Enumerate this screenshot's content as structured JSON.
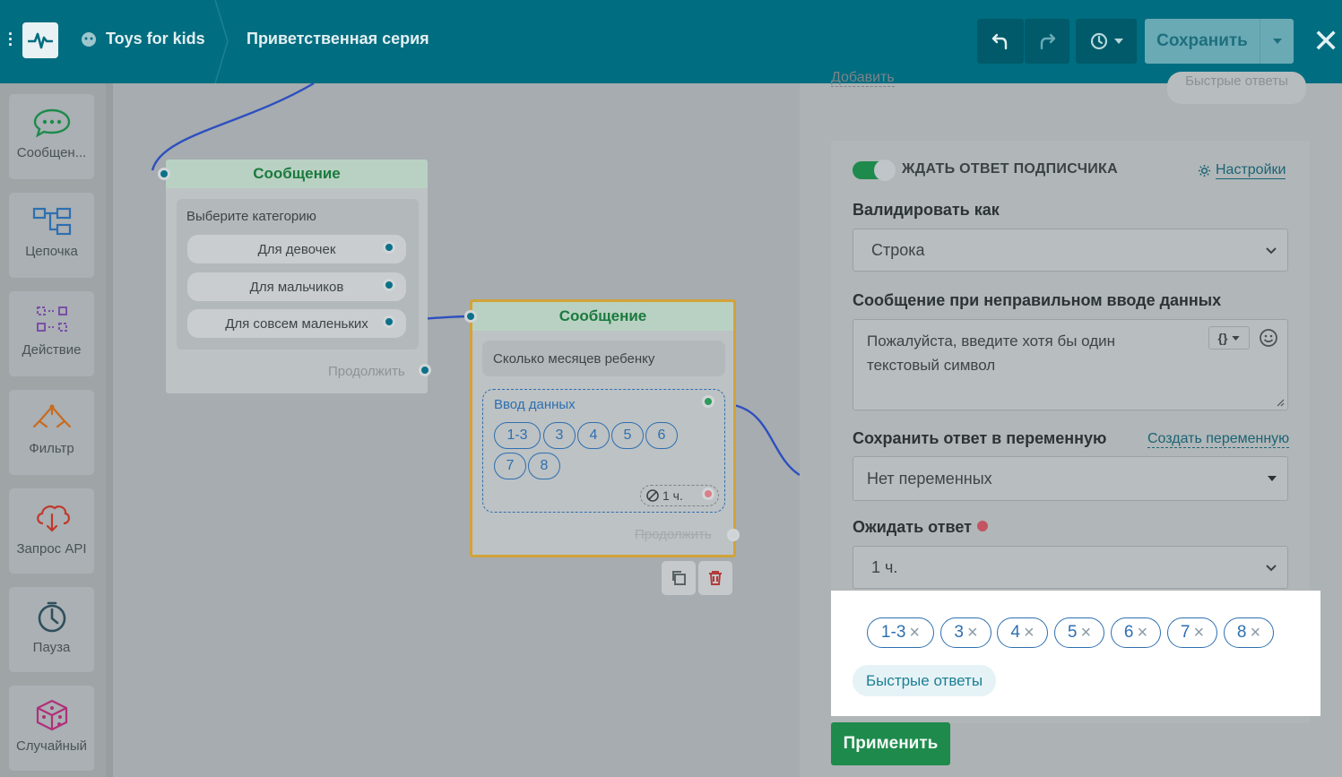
{
  "topbar": {
    "project_name": "Toys for kids",
    "series_name": "Приветственная серия",
    "save_label": "Сохранить"
  },
  "sidebar": {
    "items": [
      {
        "label": "Сообщен...",
        "icon": "chat-bubble-icon"
      },
      {
        "label": "Цепочка",
        "icon": "flowchart-icon"
      },
      {
        "label": "Действие",
        "icon": "action-icon"
      },
      {
        "label": "Фильтр",
        "icon": "filter-icon"
      },
      {
        "label": "Запрос API",
        "icon": "cloud-api-icon"
      },
      {
        "label": "Пауза",
        "icon": "stopwatch-icon"
      },
      {
        "label": "Случайный",
        "icon": "dice-icon"
      }
    ]
  },
  "canvas": {
    "node1": {
      "header": "Сообщение",
      "text": "Выберите категорию",
      "buttons": [
        "Для девочек",
        "Для мальчиков",
        "Для совсем маленьких"
      ],
      "continue": "Продолжить"
    },
    "node2": {
      "header": "Сообщение",
      "text": "Сколько месяцев ребенку",
      "input_title": "Ввод данных",
      "chips": [
        "1-3",
        "3",
        "4",
        "5",
        "6",
        "7",
        "8"
      ],
      "timer": "1 ч.",
      "continue": "Продолжить"
    }
  },
  "panel": {
    "top_link": "Добавить",
    "top_tag": "Быстрые ответы",
    "wait_title": "ЖДАТЬ ОТВЕТ ПОДПИСЧИКА",
    "settings_label": "Настройки",
    "validate_label": "Валидировать как",
    "validate_value": "Строка",
    "error_label": "Сообщение при неправильном вводе данных",
    "error_text": "Пожалуйста, введите хотя бы один текстовый символ",
    "var_button": "{}",
    "save_var_label": "Сохранить ответ в переменную",
    "create_var_link": "Создать переменную",
    "var_value": "Нет переменных",
    "wait_answer_label": "Ожидать ответ",
    "wait_answer_value": "1 ч.",
    "quick_replies": [
      "1-3",
      "3",
      "4",
      "5",
      "6",
      "7",
      "8"
    ],
    "quick_replies_button": "Быстрые ответы",
    "apply_label": "Применить"
  },
  "colors": {
    "topbar": "#006d80",
    "accent_green": "#1e8a4c",
    "chip_blue": "#2e6fb0",
    "highlight": "#ffffff"
  }
}
